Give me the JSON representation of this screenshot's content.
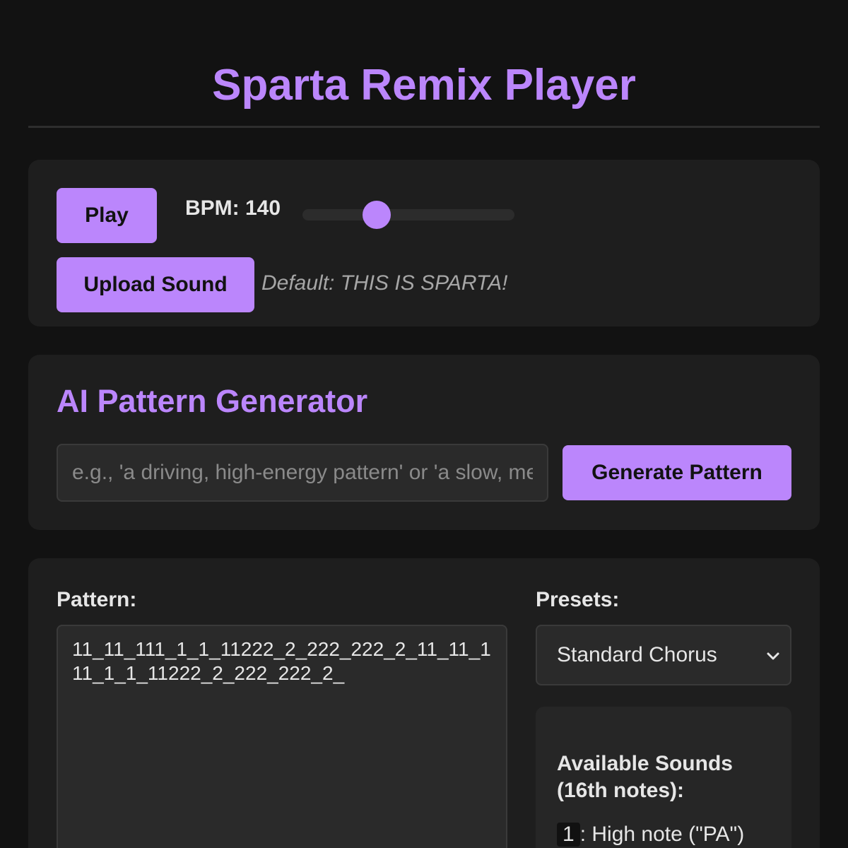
{
  "app": {
    "title": "Sparta Remix Player"
  },
  "player": {
    "play_label": "Play",
    "bpm_label": "BPM: 140",
    "bpm_value": 140,
    "bpm_fraction": 0.35,
    "upload_label": "Upload Sound",
    "default_sound_note": "Default: THIS IS SPARTA!"
  },
  "ai": {
    "heading": "AI Pattern Generator",
    "prompt_placeholder": "e.g., 'a driving, high-energy pattern' or 'a slow, menacing build-up'",
    "prompt_value": "",
    "generate_label": "Generate Pattern"
  },
  "pattern": {
    "label": "Pattern:",
    "value": "11_11_111_1_1_11222_2_222_222_2_11_11_111_1_1_11222_2_222_222_2_"
  },
  "presets": {
    "label": "Presets:",
    "selected": "Standard Chorus"
  },
  "sounds": {
    "title": "Available Sounds (16th notes):",
    "items": [
      {
        "key": "1",
        "desc": ": High note (\"PA\")"
      }
    ]
  },
  "colors": {
    "accent": "#bb86fc",
    "background": "#121212",
    "card": "#1e1e1e"
  }
}
